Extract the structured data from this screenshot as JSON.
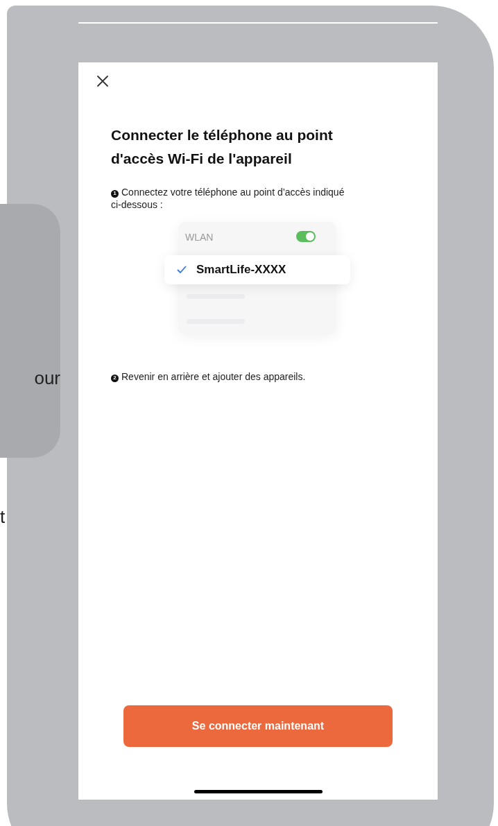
{
  "side_card": {
    "text": "our"
  },
  "side_text": "t",
  "screen": {
    "title": "Connecter le téléphone au point d'accès Wi-Fi de l'appareil",
    "steps": [
      {
        "number": "1",
        "text": "Connectez votre téléphone au point d’accès indiqué ci-dessous :"
      },
      {
        "number": "2",
        "text": "Revenir en arrière et ajouter des appareils."
      }
    ],
    "wifi_list": {
      "label": "WLAN",
      "on": true,
      "network": "SmartLife-XXXX",
      "checked": true
    },
    "button": "Se connecter maintenant"
  }
}
